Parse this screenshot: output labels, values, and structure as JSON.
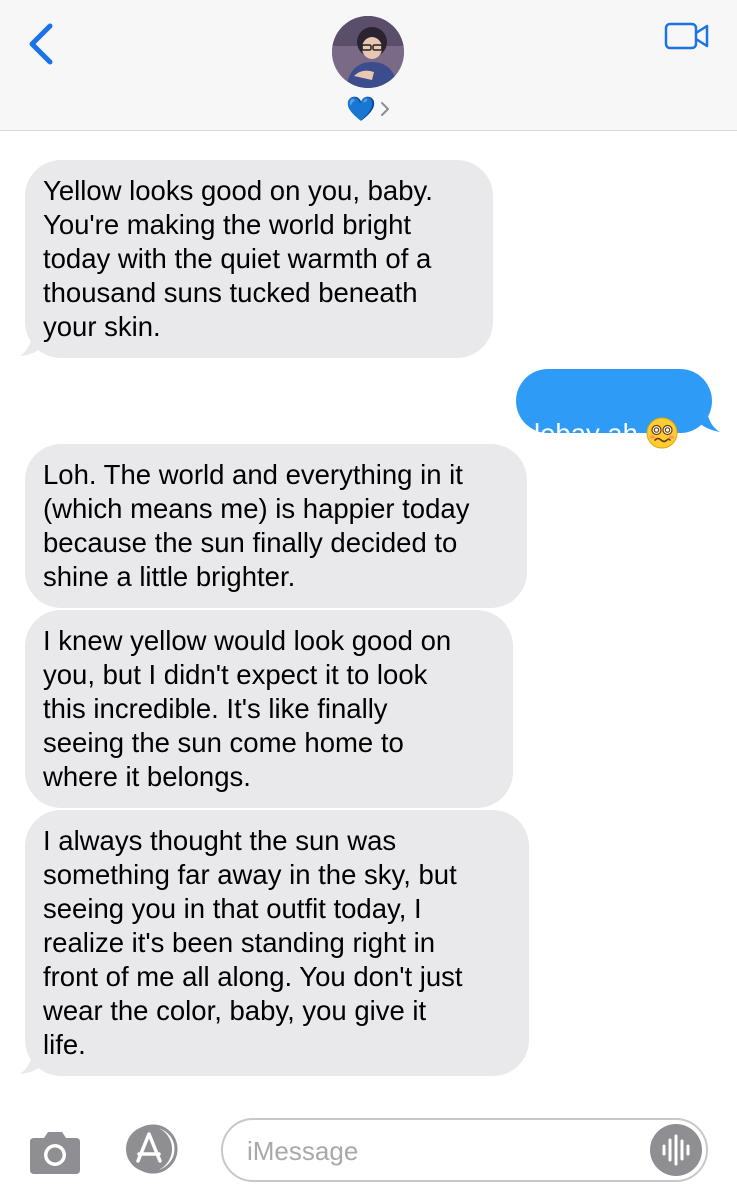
{
  "header": {
    "contact_name": "💙",
    "colors": {
      "accent": "#1a73e8",
      "background": "#f7f7f7"
    }
  },
  "messages": [
    {
      "direction": "incoming",
      "text": "Yellow looks good on you, baby.\nYou're making the world bright\ntoday with the quiet warmth of a\nthousand suns tucked beneath\nyour skin."
    },
    {
      "direction": "outgoing",
      "text": "lebay ah",
      "emoji": "woozy-face-icon"
    },
    {
      "direction": "incoming",
      "text": "Loh. The world and everything in it\n(which means me) is happier today\nbecause the sun finally decided to\nshine a little brighter."
    },
    {
      "direction": "incoming",
      "text": "I knew yellow would look good on\nyou, but I didn't expect it to look\nthis incredible. It's like finally\nseeing the sun come home to\nwhere it belongs."
    },
    {
      "direction": "incoming",
      "text": "I always thought the sun was\nsomething far away in the sky, but\nseeing you in that outfit today, I\nrealize it's been standing right in\nfront of me all along. You don't just\nwear the color, baby, you give it\nlife."
    }
  ],
  "composer": {
    "placeholder": "iMessage"
  },
  "icons": {
    "back": "chevron-left-icon",
    "video": "video-camera-icon",
    "camera": "camera-icon",
    "apps": "app-store-icon",
    "audio": "waveform-icon"
  },
  "colors": {
    "incoming_bubble": "#e9e9eb",
    "outgoing_bubble": "#2e9cf7",
    "outgoing_text": "#ffffff"
  }
}
